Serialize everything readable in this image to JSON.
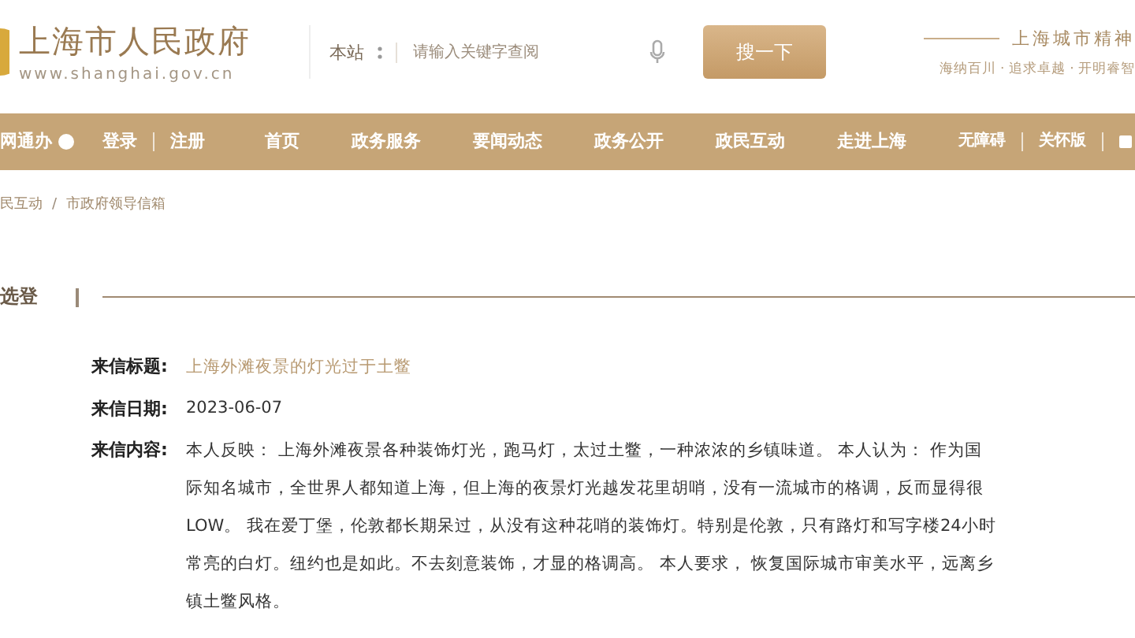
{
  "site": {
    "name": "上海市人民政府",
    "url": "www.shanghai.gov.cn"
  },
  "search": {
    "scope": "本站",
    "placeholder": "请输入关键字查阅",
    "button": "搜一下"
  },
  "motto": {
    "title": "上海城市精神",
    "text": "海纳百川 · 追求卓越 · 开明睿智"
  },
  "nav": {
    "portal": "网通办",
    "login": "登录",
    "register": "注册",
    "items": [
      {
        "label": "首页",
        "selected": false
      },
      {
        "label": "政务服务",
        "selected": false
      },
      {
        "label": "要闻动态",
        "selected": false
      },
      {
        "label": "政务公开",
        "selected": false
      },
      {
        "label": "政民互动",
        "selected": false
      },
      {
        "label": "走进上海",
        "selected": false
      }
    ],
    "tools": [
      "无障碍",
      "关怀版"
    ]
  },
  "breadcrumb": [
    "民互动",
    "市政府领导信箱"
  ],
  "breadcrumb_separator": "/",
  "section_title": "选登",
  "letter": [
    {
      "label": "来信标题:",
      "value": "上海外滩夜景的灯光过于土鳖",
      "kind": "title"
    },
    {
      "label": "来信日期:",
      "value": "2023-06-07",
      "kind": "plain"
    },
    {
      "label": "来信内容:",
      "value": "本人反映： 上海外滩夜景各种装饰灯光，跑马灯，太过土鳖，一种浓浓的乡镇味道。 本人认为： 作为国际知名城市，全世界人都知道上海，但上海的夜景灯光越发花里胡哨，没有一流城市的格调，反而显得很LOW。 我在爱丁堡，伦敦都长期呆过，从没有这种花哨的装饰灯。特别是伦敦，只有路灯和写字楼24小时常亮的白灯。纽约也是如此。不去刻意装饰，才显的格调高。 本人要求， 恢复国际城市审美水平，远离乡镇土鳖风格。",
      "kind": "plain"
    }
  ]
}
